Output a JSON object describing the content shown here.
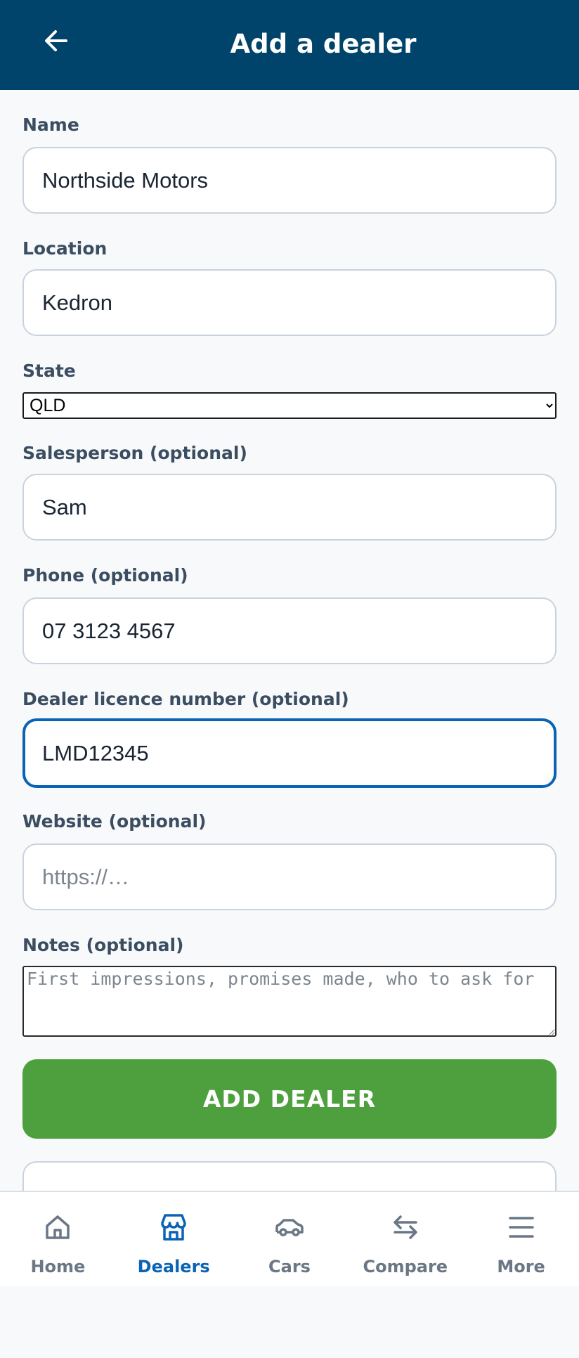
{
  "header": {
    "title": "Add a dealer",
    "back_icon": "arrow-left-icon"
  },
  "form": {
    "name": {
      "label": "Name",
      "value": "Northside Motors"
    },
    "location": {
      "label": "Location",
      "value": "Kedron"
    },
    "state": {
      "label": "State",
      "selected": "QLD"
    },
    "salesperson": {
      "label": "Salesperson (optional)",
      "value": "Sam"
    },
    "phone": {
      "label": "Phone (optional)",
      "value": "07 3123 4567"
    },
    "licence": {
      "label": "Dealer licence number (optional)",
      "value": "LMD12345"
    },
    "website": {
      "label": "Website (optional)",
      "value": "",
      "placeholder": "https://…"
    },
    "notes": {
      "label": "Notes (optional)",
      "value": "",
      "placeholder": "First impressions, promises made, who to ask for"
    },
    "submit_label": "ADD DEALER"
  },
  "nav": {
    "items": [
      {
        "label": "Home",
        "icon": "home-icon",
        "active": false
      },
      {
        "label": "Dealers",
        "icon": "store-icon",
        "active": true
      },
      {
        "label": "Cars",
        "icon": "car-icon",
        "active": false
      },
      {
        "label": "Compare",
        "icon": "compare-arrows-icon",
        "active": false
      },
      {
        "label": "More",
        "icon": "menu-icon",
        "active": false
      }
    ]
  },
  "colors": {
    "header_bg": "#00436b",
    "primary_button": "#4e9f3d",
    "active_nav": "#0b63b4",
    "focus_ring": "#0b63b4"
  }
}
